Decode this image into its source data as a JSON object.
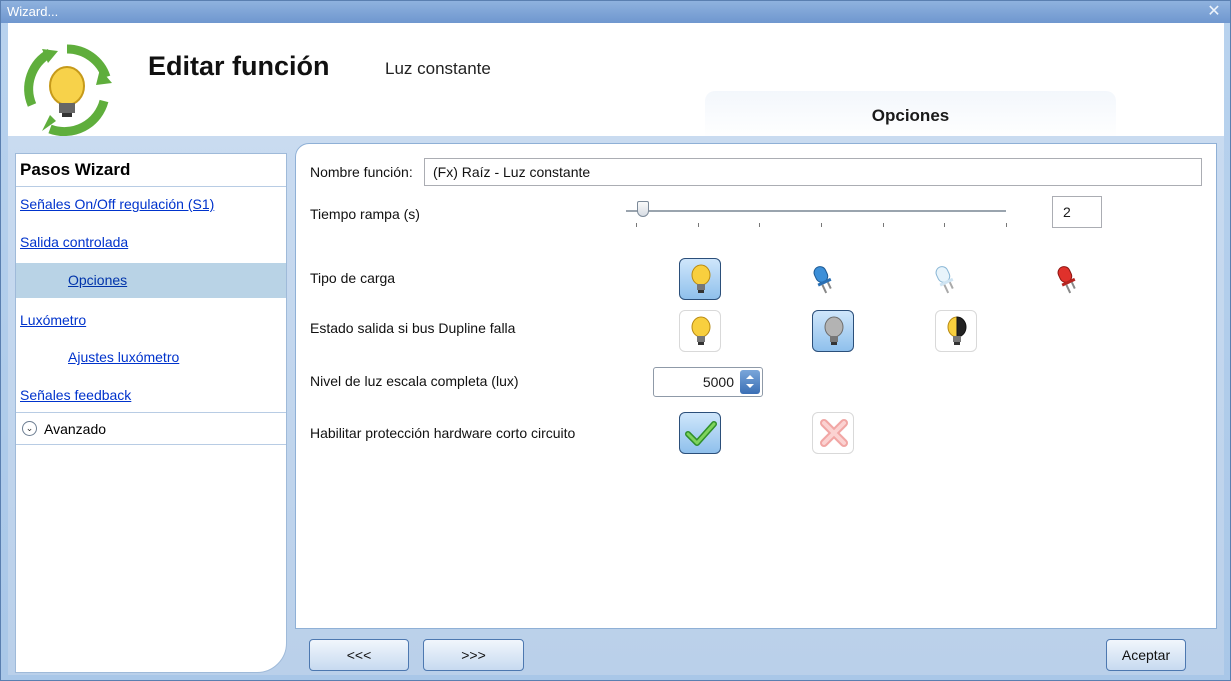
{
  "window": {
    "title": "Wizard...",
    "close_glyph": "✕"
  },
  "header": {
    "title": "Editar función",
    "subtitle": "Luz constante",
    "tab_label": "Opciones",
    "logo_icon": "lightbulb-cycle-icon"
  },
  "sidebar": {
    "title": "Pasos Wizard",
    "items": [
      {
        "label": "Señales On/Off regulación (S1)"
      },
      {
        "label": "Salida controlada"
      },
      {
        "label": "Opciones",
        "active": true
      },
      {
        "label": "Luxómetro"
      },
      {
        "label": "Ajustes luxómetro"
      },
      {
        "label": "Señales feedback"
      }
    ],
    "advanced_label": "Avanzado",
    "advanced_icon": "chevron-down-icon"
  },
  "form": {
    "name_label": "Nombre función:",
    "name_value": "(Fx) Raíz - Luz constante",
    "ramp_label": "Tiempo rampa (s)",
    "ramp_value": "2",
    "load_label": "Tipo de carga",
    "load_options": [
      "incandescent-bulb-icon",
      "blue-led-icon",
      "white-led-icon",
      "red-led-icon"
    ],
    "load_selected": "incandescent-bulb-icon",
    "fail_label": "Estado salida si bus Dupline falla",
    "fail_options": [
      "bulb-on-icon",
      "bulb-off-icon",
      "bulb-half-icon"
    ],
    "fail_selected": "bulb-off-icon",
    "lux_label": "Nivel de luz escala completa (lux)",
    "lux_value": "5000",
    "hw_label": "Habilitar protección hardware corto circuito",
    "hw_options": [
      "check-icon",
      "cross-icon"
    ],
    "hw_selected": "check-icon"
  },
  "footer": {
    "back_label": "<<<",
    "next_label": ">>>",
    "accept_label": "Aceptar"
  },
  "colors": {
    "frame": "#a9c7e8",
    "link": "#0033cc",
    "selected_button": "#8fc0ec",
    "active_step": "#b9d3e6"
  }
}
